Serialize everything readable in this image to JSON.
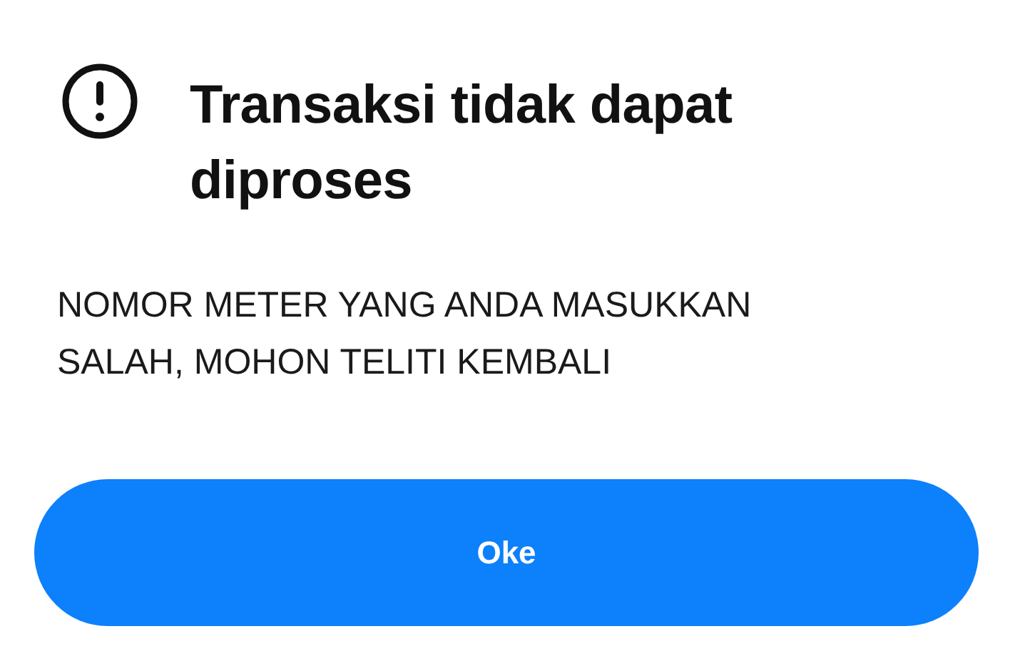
{
  "dialog": {
    "title": "Transaksi tidak dapat diproses",
    "message": "NOMOR METER YANG ANDA MASUKKAN SALAH, MOHON TELITI KEMBALI",
    "buttons": [
      {
        "label": "Oke",
        "kind": "primary"
      }
    ]
  }
}
